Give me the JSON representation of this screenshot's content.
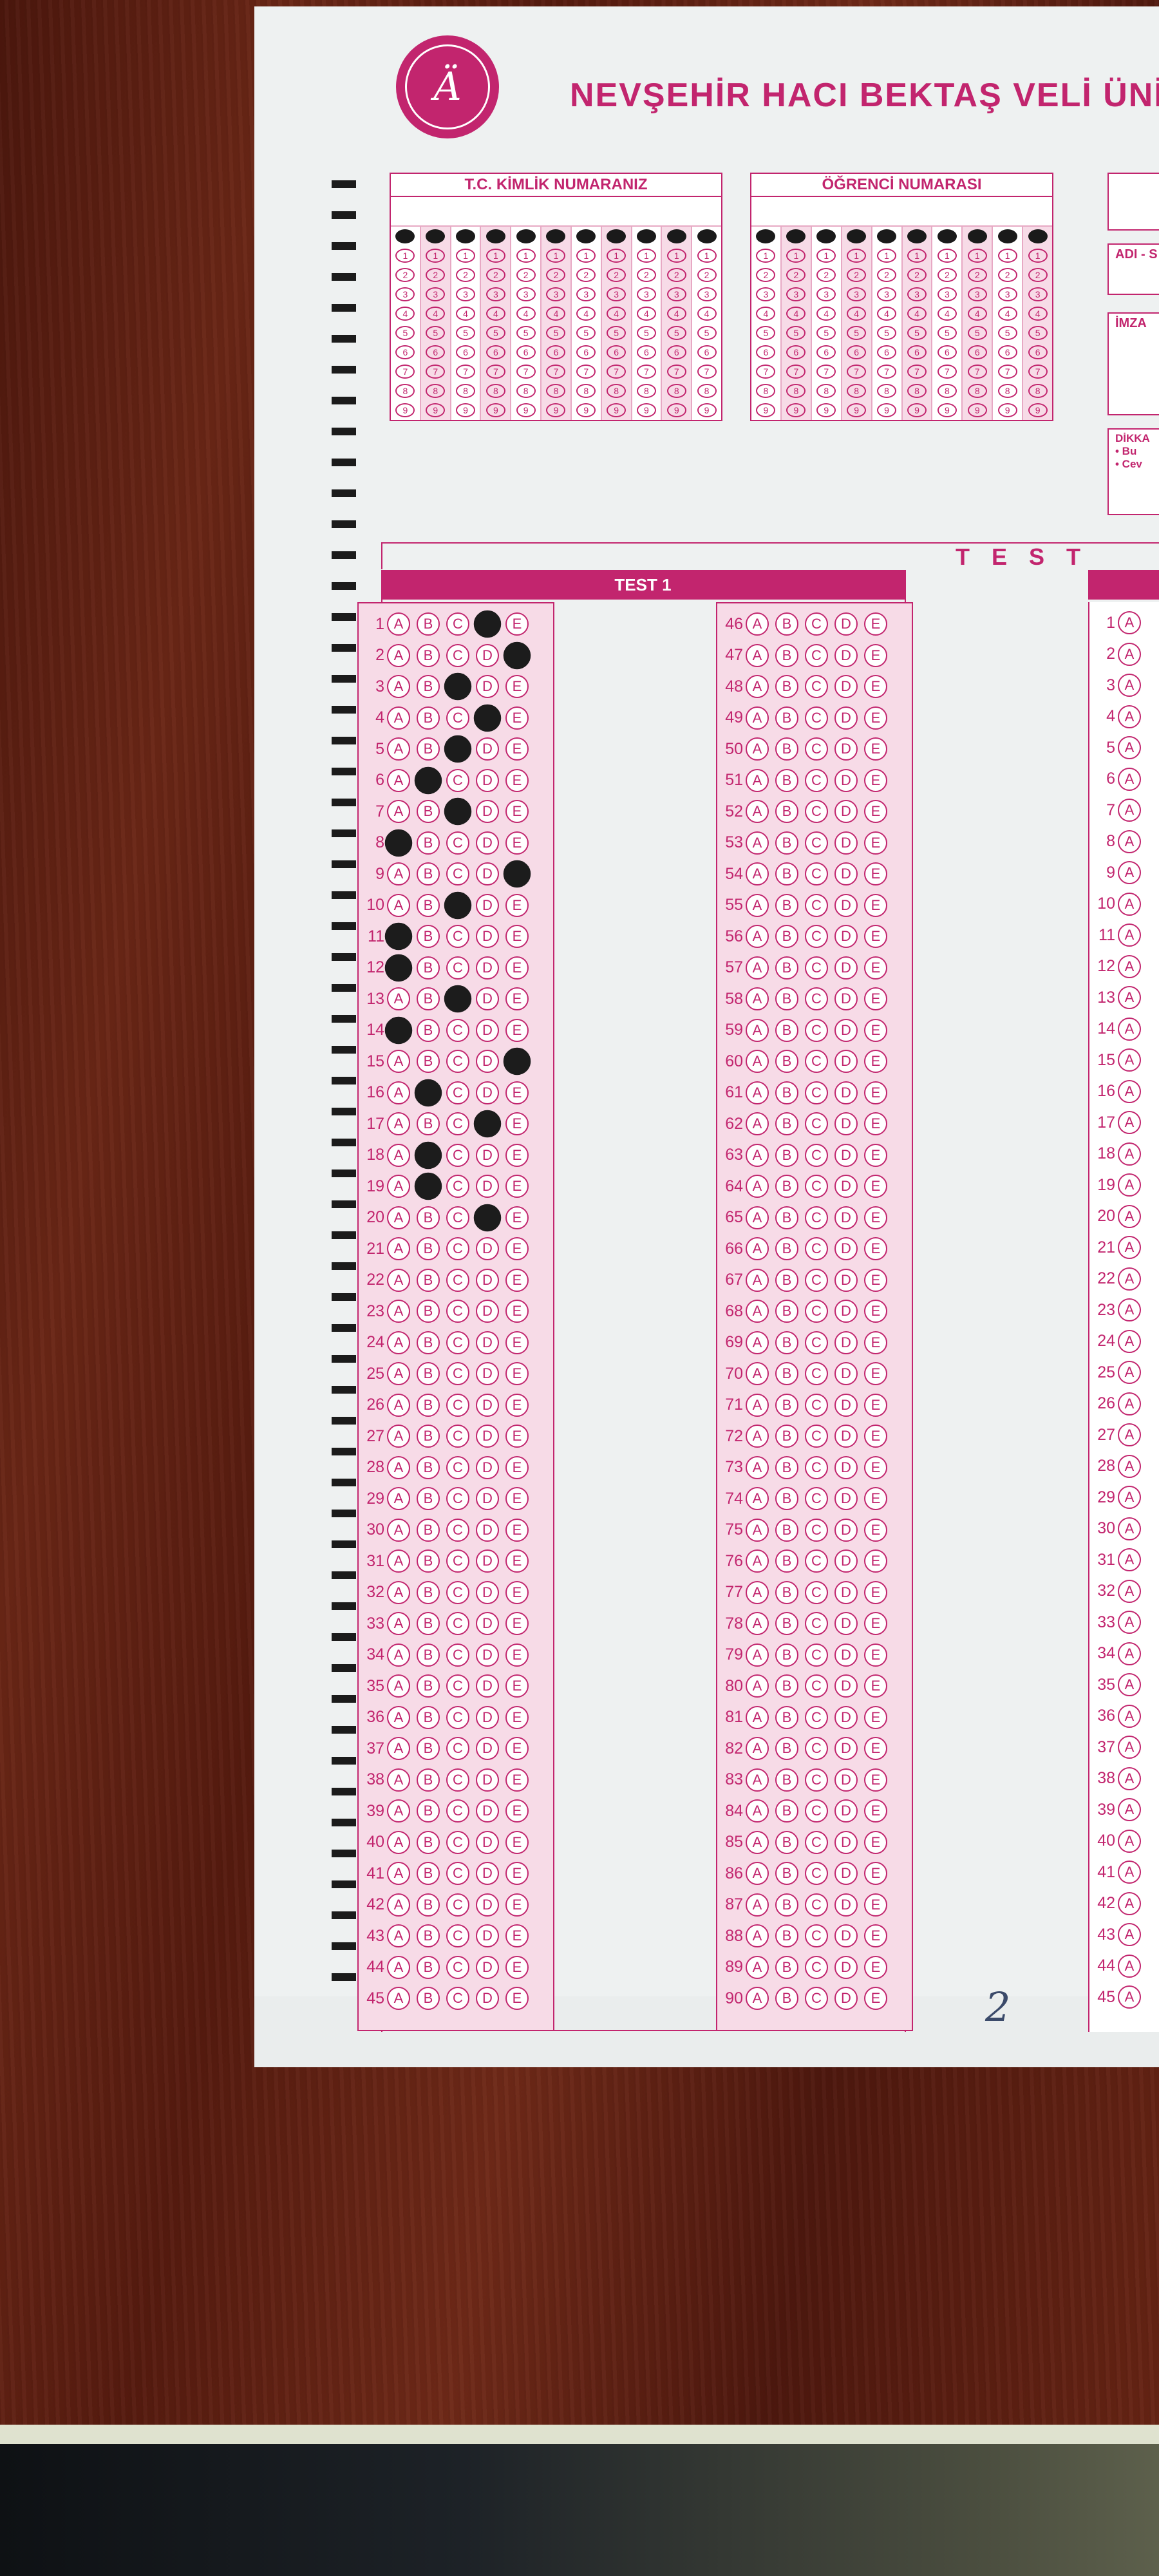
{
  "header": {
    "university": "NEVŞEHİR HACI BEKTAŞ VELİ ÜNİV",
    "logo_glyph": "Ä"
  },
  "id_fields": {
    "tc_label": "T.C. KİMLİK NUMARANIZ",
    "student_label": "ÖĞRENCİ NUMARASI",
    "digits": [
      "0",
      "1",
      "2",
      "3",
      "4",
      "5",
      "6",
      "7",
      "8",
      "9"
    ],
    "tc_columns": 11,
    "student_columns": 10,
    "filled_digit_row": "0"
  },
  "right_fields": {
    "name_label": "ADI - S",
    "signature_label": "İMZA",
    "notice_label": "DİKKA",
    "notice_line1": "• Bu",
    "notice_line2": "• Cev"
  },
  "test": {
    "section_title": "T E S T",
    "test1_label": "TEST 1",
    "options": [
      "A",
      "B",
      "C",
      "D",
      "E"
    ],
    "column1_start": 1,
    "column2_start": 46,
    "rows_per_column": 45,
    "test1_answers": {
      "1": "D",
      "2": "E",
      "3": "C",
      "4": "D",
      "5": "C",
      "6": "B",
      "7": "C",
      "8": "A",
      "9": "E",
      "10": "C",
      "11": "A",
      "12": "A",
      "13": "C",
      "14": "A",
      "15": "E",
      "16": "B",
      "17": "D",
      "18": "B",
      "19": "B",
      "20": "D"
    }
  },
  "handwriting": "2",
  "colors": {
    "form_pink": "#c2256e",
    "mark": "#1c1c1c",
    "desk": "#5a1f12"
  }
}
